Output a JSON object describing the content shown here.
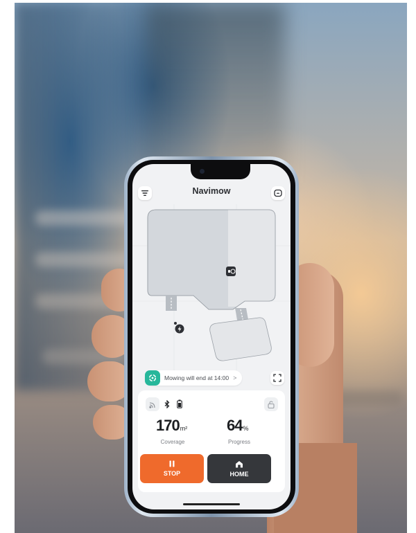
{
  "app": {
    "title": "Navimow"
  },
  "header": {
    "menu_icon": "menu-lines-icon",
    "right_icon": "minus-square-icon"
  },
  "map": {
    "mower_icon": "mower-icon",
    "station_icon": "charging-station-icon"
  },
  "status_pill": {
    "icon": "mowing-status-icon",
    "text": "Mowing will end at 14:00",
    "chevron": ">"
  },
  "map_fit_icon": "fit-screen-icon",
  "control_card": {
    "status_icons": [
      "signal-icon",
      "bluetooth-icon",
      "battery-icon"
    ],
    "lock_icon": "unlock-icon",
    "coverage": {
      "value": "170",
      "unit": "m²",
      "label": "Coverage"
    },
    "progress": {
      "value": "64",
      "unit": "%",
      "label": "Progress",
      "fraction": 0.64
    },
    "stop_button": {
      "label": "STOP",
      "icon": "pause-icon",
      "color": "#ef6a2c"
    },
    "home_button": {
      "label": "HOME",
      "icon": "home-icon",
      "color": "#35373b"
    }
  },
  "colors": {
    "accent_green": "#27b79b",
    "stop_orange": "#ef6a2c",
    "home_dark": "#35373b"
  }
}
